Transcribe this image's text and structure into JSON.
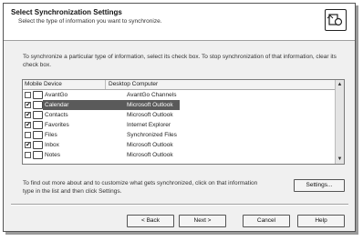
{
  "header": {
    "title": "Select Synchronization Settings",
    "subtitle": "Select the type of information you want to synchronize.",
    "icon": "sync-settings-icon"
  },
  "instructions": "To synchronize a particular type of information, select its check box. To stop synchronization of that information, clear its check box.",
  "list": {
    "columns": [
      "Mobile Device",
      "Desktop Computer"
    ],
    "rows": [
      {
        "device": "AvantGo",
        "desktop": "AvantGo Channels",
        "checked": false,
        "selected": false,
        "icon": "avantgo-icon"
      },
      {
        "device": "Calendar",
        "desktop": "Microsoft Outlook",
        "checked": true,
        "selected": true,
        "icon": "calendar-icon"
      },
      {
        "device": "Contacts",
        "desktop": "Microsoft Outlook",
        "checked": true,
        "selected": false,
        "icon": "contacts-icon"
      },
      {
        "device": "Favorites",
        "desktop": "Internet Explorer",
        "checked": true,
        "selected": false,
        "icon": "favorites-icon"
      },
      {
        "device": "Files",
        "desktop": "Synchronized Files",
        "checked": false,
        "selected": false,
        "icon": "files-icon"
      },
      {
        "device": "Inbox",
        "desktop": "Microsoft Outlook",
        "checked": true,
        "selected": false,
        "icon": "inbox-icon"
      },
      {
        "device": "Notes",
        "desktop": "Microsoft Outlook",
        "checked": false,
        "selected": false,
        "icon": "notes-icon"
      }
    ]
  },
  "note": "To find out more about and to customize what gets synchronized, click on that information type in the list and then click Settings.",
  "buttons": {
    "settings": "Settings...",
    "back": "< Back",
    "next": "Next >",
    "cancel": "Cancel",
    "help": "Help"
  },
  "colors": {
    "selection": "#5a5a5a",
    "dialog_bg": "#f0f0f0"
  }
}
